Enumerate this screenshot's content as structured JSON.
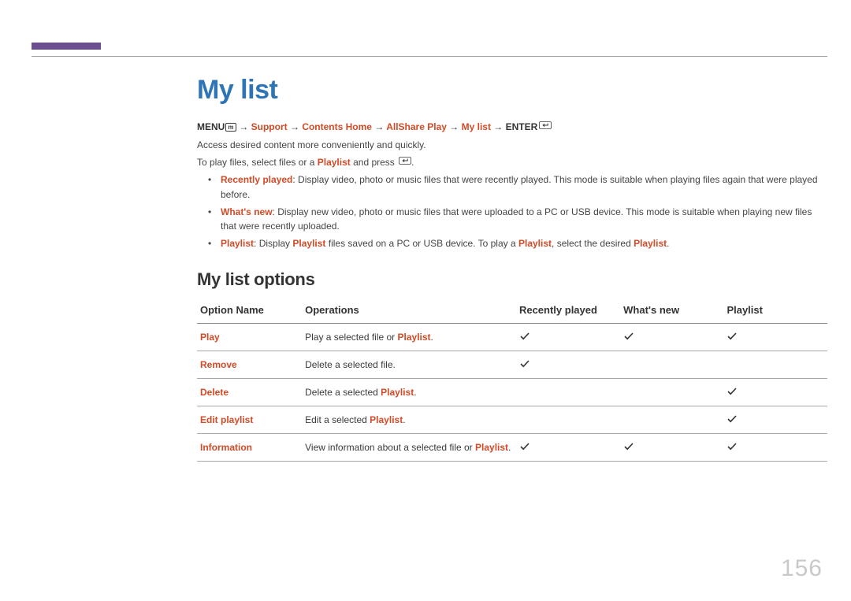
{
  "page_number": "156",
  "title": "My list",
  "breadcrumb": {
    "parts": [
      "MENU",
      " → ",
      "Support",
      " → ",
      "Contents Home",
      " → ",
      "AllShare Play",
      " → ",
      "My list",
      " → ",
      "ENTER"
    ],
    "menu_icon_label": "m",
    "enter_icon": true
  },
  "intro": {
    "line1": "Access desired content more conveniently and quickly.",
    "line2_prefix": "To play files, select files or a ",
    "line2_accent": "Playlist",
    "line2_suffix": " and press ",
    "line2_has_enter_icon": true
  },
  "bullets": [
    {
      "lead": "Recently played",
      "text": ": Display video, photo or music files that were recently played. This mode is suitable when playing files again that were played before."
    },
    {
      "lead": "What's new",
      "text": ": Display new video, photo or music files that were uploaded to a PC or USB device. This mode is suitable when playing new files that were recently uploaded."
    },
    {
      "lead": "Playlist",
      "rich": [
        {
          "t": ": Display "
        },
        {
          "t": "Playlist",
          "accent": true
        },
        {
          "t": " files saved on a PC or USB device. To play a "
        },
        {
          "t": "Playlist",
          "accent": true
        },
        {
          "t": ", select the desired "
        },
        {
          "t": "Playlist",
          "accent": true
        },
        {
          "t": "."
        }
      ]
    }
  ],
  "section2_title": "My list options",
  "table": {
    "headers": [
      "Option Name",
      "Operations",
      "Recently played",
      "What's new",
      "Playlist"
    ],
    "rows": [
      {
        "option": "Play",
        "op_parts": [
          {
            "t": "Play a selected file or "
          },
          {
            "t": "Playlist",
            "accent": true
          },
          {
            "t": "."
          }
        ],
        "recently": true,
        "whatsnew": true,
        "playlist": true
      },
      {
        "option": "Remove",
        "op_parts": [
          {
            "t": "Delete a selected file."
          }
        ],
        "recently": true,
        "whatsnew": false,
        "playlist": false
      },
      {
        "option": "Delete",
        "op_parts": [
          {
            "t": "Delete a selected "
          },
          {
            "t": "Playlist",
            "accent": true
          },
          {
            "t": "."
          }
        ],
        "recently": false,
        "whatsnew": false,
        "playlist": true
      },
      {
        "option": "Edit playlist",
        "op_parts": [
          {
            "t": "Edit a selected "
          },
          {
            "t": "Playlist",
            "accent": true
          },
          {
            "t": "."
          }
        ],
        "recently": false,
        "whatsnew": false,
        "playlist": true
      },
      {
        "option": "Information",
        "op_parts": [
          {
            "t": "View information about a selected file or "
          },
          {
            "t": "Playlist",
            "accent": true
          },
          {
            "t": "."
          }
        ],
        "recently": true,
        "whatsnew": true,
        "playlist": true
      }
    ]
  }
}
